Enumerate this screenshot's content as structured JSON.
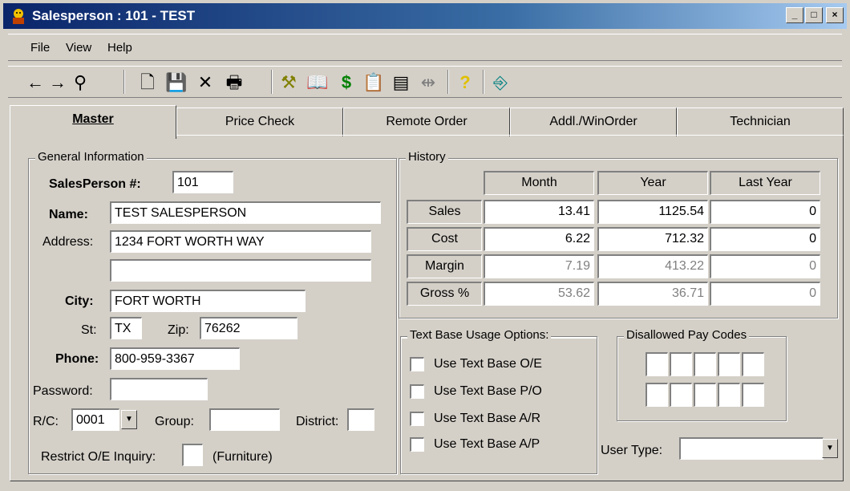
{
  "window": {
    "title": "Salesperson : 101 - TEST"
  },
  "menu": {
    "file": "File",
    "view": "View",
    "help": "Help"
  },
  "toolbar": {
    "back": "←",
    "forward": "→",
    "find": "⚲",
    "new": "🗋",
    "save": "💾",
    "delete": "✕",
    "print": "🖶",
    "dollar": "$",
    "help": "?"
  },
  "tabs": [
    {
      "label": "Master"
    },
    {
      "label": "Price Check"
    },
    {
      "label": "Remote Order"
    },
    {
      "label": "Addl./WinOrder"
    },
    {
      "label": "Technician"
    }
  ],
  "general": {
    "title": "General Information",
    "salesperson_label": "SalesPerson #:",
    "salesperson": "101",
    "name_label": "Name:",
    "name": "TEST SALESPERSON",
    "address_label": "Address:",
    "address1": "1234 FORT WORTH WAY",
    "address2": "",
    "city_label": "City:",
    "city": "FORT WORTH",
    "st_label": "St:",
    "st": "TX",
    "zip_label": "Zip:",
    "zip": "76262",
    "phone_label": "Phone:",
    "phone": "800-959-3367",
    "password_label": "Password:",
    "password": "",
    "rc_label": "R/C:",
    "rc": "0001",
    "group_label": "Group:",
    "group": "",
    "district_label": "District:",
    "district": "",
    "restrict_label": "Restrict O/E Inquiry:",
    "restrict_note": "(Furniture)"
  },
  "history": {
    "title": "History",
    "columns": [
      "Month",
      "Year",
      "Last Year"
    ],
    "rows": [
      {
        "label": "Sales",
        "values": [
          "13.41",
          "1125.54",
          "0"
        ]
      },
      {
        "label": "Cost",
        "values": [
          "6.22",
          "712.32",
          "0"
        ]
      },
      {
        "label": "Margin",
        "values": [
          "7.19",
          "413.22",
          "0"
        ]
      },
      {
        "label": "Gross %",
        "values": [
          "53.62",
          "36.71",
          "0"
        ]
      }
    ]
  },
  "text_base": {
    "title": "Text Base Usage Options:",
    "options": [
      "Use Text Base O/E",
      "Use Text Base P/O",
      "Use Text Base A/R",
      "Use Text Base A/P"
    ]
  },
  "disallowed": {
    "title": "Disallowed Pay Codes"
  },
  "user_type": {
    "label": "User Type:",
    "value": ""
  }
}
